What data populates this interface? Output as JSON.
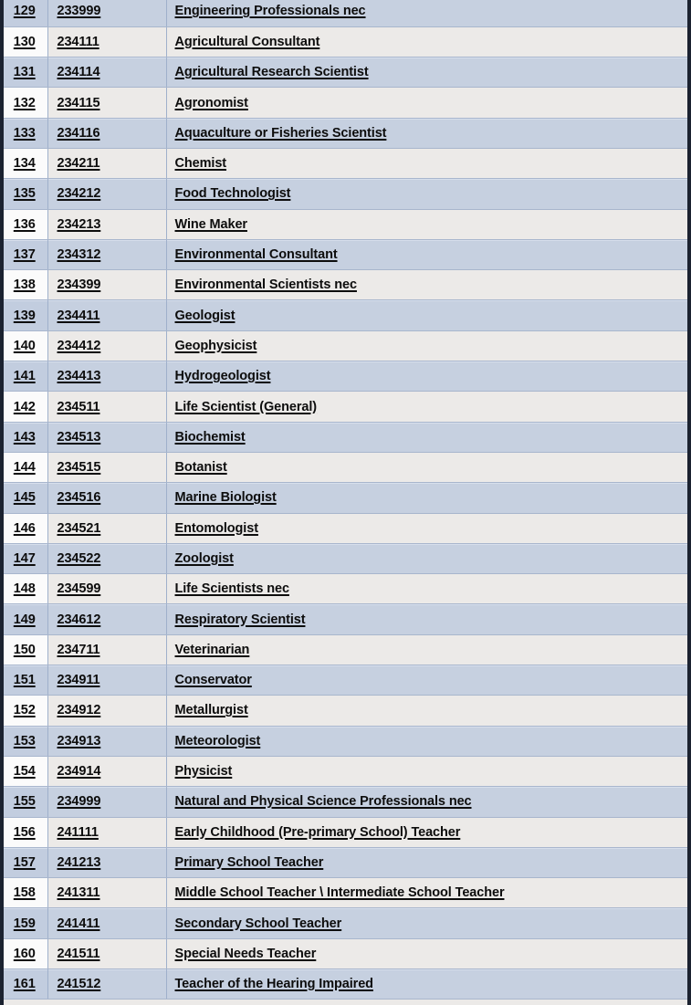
{
  "document": {
    "type": "occupation-code-table",
    "columns": [
      "index",
      "code",
      "occupation"
    ],
    "visible_row_range": {
      "first": 129,
      "last": 161
    },
    "colors": {
      "band_blue": "#c6d0e0",
      "band_light": "#eceae8",
      "index_light": "#fbfbfb",
      "grid_line": "#a8b6cd",
      "outer_frame": "#1b2230",
      "text": "#0d0d0d"
    }
  },
  "rows": [
    {
      "index": "129",
      "code": "233999",
      "occupation": "Engineering Professionals nec"
    },
    {
      "index": "130",
      "code": "234111",
      "occupation": "Agricultural Consultant"
    },
    {
      "index": "131",
      "code": "234114",
      "occupation": "Agricultural Research Scientist"
    },
    {
      "index": "132",
      "code": "234115",
      "occupation": "Agronomist"
    },
    {
      "index": "133",
      "code": "234116",
      "occupation": "Aquaculture or Fisheries Scientist"
    },
    {
      "index": "134",
      "code": "234211",
      "occupation": "Chemist"
    },
    {
      "index": "135",
      "code": "234212",
      "occupation": "Food Technologist"
    },
    {
      "index": "136",
      "code": "234213",
      "occupation": "Wine Maker"
    },
    {
      "index": "137",
      "code": "234312",
      "occupation": "Environmental Consultant"
    },
    {
      "index": "138",
      "code": "234399",
      "occupation": "Environmental Scientists nec"
    },
    {
      "index": "139",
      "code": "234411",
      "occupation": "Geologist"
    },
    {
      "index": "140",
      "code": "234412",
      "occupation": "Geophysicist"
    },
    {
      "index": "141",
      "code": "234413",
      "occupation": "Hydrogeologist"
    },
    {
      "index": "142",
      "code": "234511",
      "occupation": "Life Scientist (General)"
    },
    {
      "index": "143",
      "code": "234513",
      "occupation": "Biochemist"
    },
    {
      "index": "144",
      "code": "234515",
      "occupation": "Botanist"
    },
    {
      "index": "145",
      "code": "234516",
      "occupation": "Marine Biologist"
    },
    {
      "index": "146",
      "code": "234521",
      "occupation": "Entomologist"
    },
    {
      "index": "147",
      "code": "234522",
      "occupation": "Zoologist"
    },
    {
      "index": "148",
      "code": "234599",
      "occupation": "Life Scientists nec"
    },
    {
      "index": "149",
      "code": "234612",
      "occupation": "Respiratory Scientist"
    },
    {
      "index": "150",
      "code": "234711",
      "occupation": "Veterinarian"
    },
    {
      "index": "151",
      "code": "234911",
      "occupation": "Conservator"
    },
    {
      "index": "152",
      "code": "234912",
      "occupation": "Metallurgist"
    },
    {
      "index": "153",
      "code": "234913",
      "occupation": "Meteorologist"
    },
    {
      "index": "154",
      "code": "234914",
      "occupation": "Physicist"
    },
    {
      "index": "155",
      "code": "234999",
      "occupation": "Natural and Physical Science Professionals nec"
    },
    {
      "index": "156",
      "code": "241111",
      "occupation": "Early Childhood (Pre-primary School) Teacher"
    },
    {
      "index": "157",
      "code": "241213",
      "occupation": "Primary School Teacher"
    },
    {
      "index": "158",
      "code": "241311",
      "occupation": "Middle School Teacher \\ Intermediate School Teacher"
    },
    {
      "index": "159",
      "code": "241411",
      "occupation": "Secondary School Teacher"
    },
    {
      "index": "160",
      "code": "241511",
      "occupation": "Special Needs Teacher"
    },
    {
      "index": "161",
      "code": "241512",
      "occupation": "Teacher of the Hearing Impaired"
    }
  ]
}
